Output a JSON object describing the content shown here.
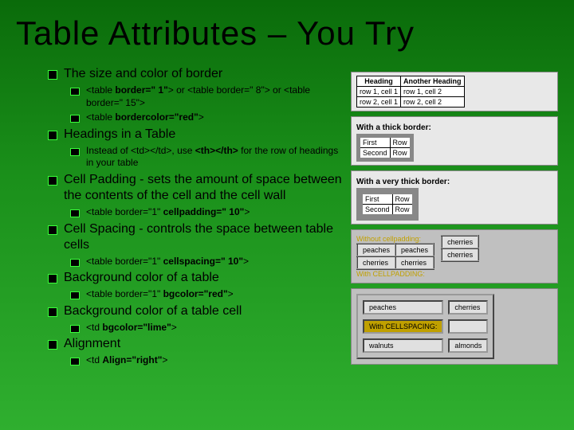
{
  "title": "Table Attributes – You Try",
  "b1": {
    "heading": "The size and color of border",
    "sub1a_html": "<table <b>border=\" 1\"</b>>  or <table border=\" 8\"> or <table border=\" 15\">",
    "sub1b_html": "<table <b>bordercolor=\"red\"</b>>"
  },
  "b2": {
    "heading": "Headings in a Table",
    "sub_html": "Instead of <td></td>, use <b><th></th></b> for the row of headings in your table"
  },
  "b3": {
    "heading": "Cell Padding - sets the amount of space between the contents of the cell and the cell wall",
    "sub_html": "<table border=\"1\" <b>cellpadding=\" 10\"</b>>"
  },
  "b4": {
    "heading": "Cell Spacing - controls the space between table cells",
    "sub_html": "<table border=\"1\"  <b>cellspacing=\" 10\"</b>>"
  },
  "b5": {
    "heading": "Background color of a table",
    "sub_html": "<table border=\"1\" <b>bgcolor=\"red\"</b>>"
  },
  "b6": {
    "heading": "Background color of a table cell",
    "sub_html": "<td <b>bgcolor=\"lime\"</b>>"
  },
  "b7": {
    "heading": "Alignment",
    "sub_html": "<td <b>Align=\"right\"</b>>"
  },
  "figs": {
    "thead_h1": "Heading",
    "thead_h2": "Another Heading",
    "r1c1": "row 1, cell 1",
    "r1c2": "row 1, cell 2",
    "r2c1": "row 2, cell 1",
    "r2c2": "row 2, cell 2",
    "cap_thick": "With a thick border:",
    "cap_vthick": "With a very thick border:",
    "first": "First",
    "row": "Row",
    "second": "Second",
    "peaches": "peaches",
    "cherries": "cherries",
    "walnuts": "walnuts",
    "almonds": "almonds",
    "no_cp": "Without cellpadding:",
    "with_cp": "With CELLPADDING:",
    "with_cs": "With CELLSPACING:"
  }
}
